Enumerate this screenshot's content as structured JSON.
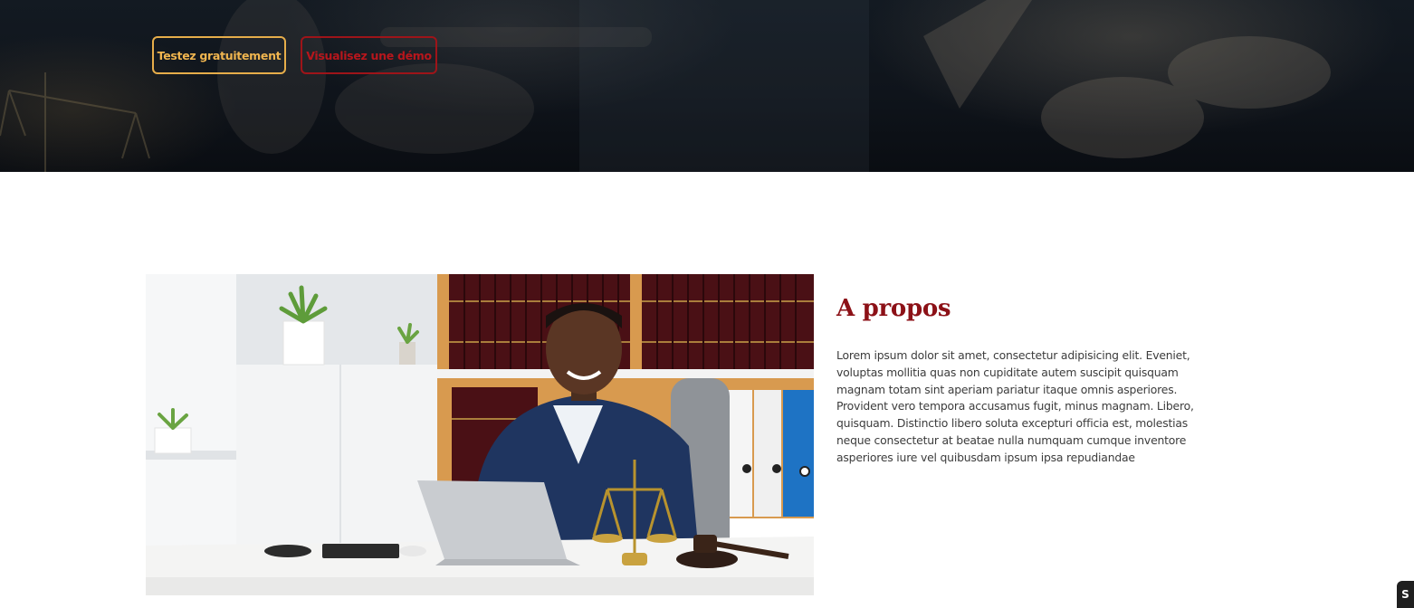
{
  "hero": {
    "buttons": {
      "trial_label": "Testez gratuitement",
      "demo_label": "Visualisez une démo"
    },
    "colors": {
      "overlay": "#0f141b",
      "trial_border": "#e6ad4a",
      "demo_border": "#9e1419"
    }
  },
  "about": {
    "title": "A propos",
    "body": "Lorem ipsum dolor sit amet, consectetur adipisicing elit. Eveniet, voluptas mollitia quas non cupiditate autem suscipit quisquam magnam totam sint aperiam pariatur itaque omnis asperiores. Provident vero tempora accusamus fugit, minus magnam. Libero, quisquam. Distinctio libero soluta excepturi officia est, molestias neque consectetur at beatae nulla numquam cumque inventore asperiores iure vel quibusdam ipsum ipsa repudiandae",
    "colors": {
      "title": "#8c1117",
      "text": "#3c3c3c"
    }
  },
  "photo": {
    "icon": "lawyer-office-photo"
  },
  "widget": {
    "icon": "site-badge-icon",
    "glyph": "S"
  }
}
